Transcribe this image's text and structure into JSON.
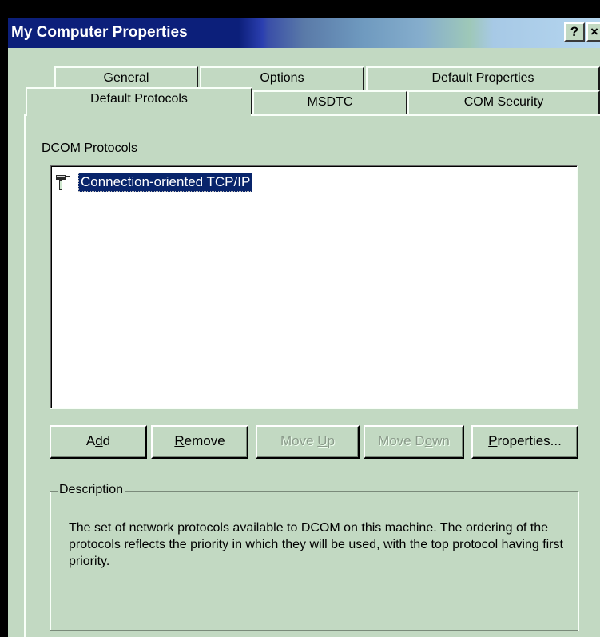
{
  "window": {
    "title": "My Computer Properties",
    "help_button": "?",
    "close_button": "×"
  },
  "tabs": {
    "row1": [
      "General",
      "Options",
      "Default Properties"
    ],
    "row2": [
      "Default Protocols",
      "MSDTC",
      "COM Security"
    ],
    "selected": "Default Protocols"
  },
  "protocols": {
    "label_pre": "DCO",
    "label_accel": "M",
    "label_post": " Protocols",
    "items": [
      {
        "label": "Connection-oriented TCP/IP",
        "icon": "network-plug-icon",
        "selected": true
      }
    ]
  },
  "buttons": {
    "add": {
      "pre": "A",
      "accel": "d",
      "post": "d",
      "enabled": true
    },
    "remove": {
      "pre": "",
      "accel": "R",
      "post": "emove",
      "enabled": true
    },
    "move_up": {
      "pre": "Move ",
      "accel": "U",
      "post": "p",
      "enabled": false
    },
    "move_down": {
      "pre": "Move D",
      "accel": "o",
      "post": "wn",
      "enabled": false
    },
    "properties": {
      "pre": "",
      "accel": "P",
      "post": "roperties...",
      "enabled": true
    }
  },
  "description": {
    "title": "Description",
    "text": "The set of network protocols available to DCOM on this machine. The ordering of the protocols reflects the priority in which they will be used, with the top protocol having first priority."
  },
  "colors": {
    "titlebar_active": "#0c1f7a",
    "dialog_face": "#c2d9c2",
    "selection": "#08246b"
  }
}
